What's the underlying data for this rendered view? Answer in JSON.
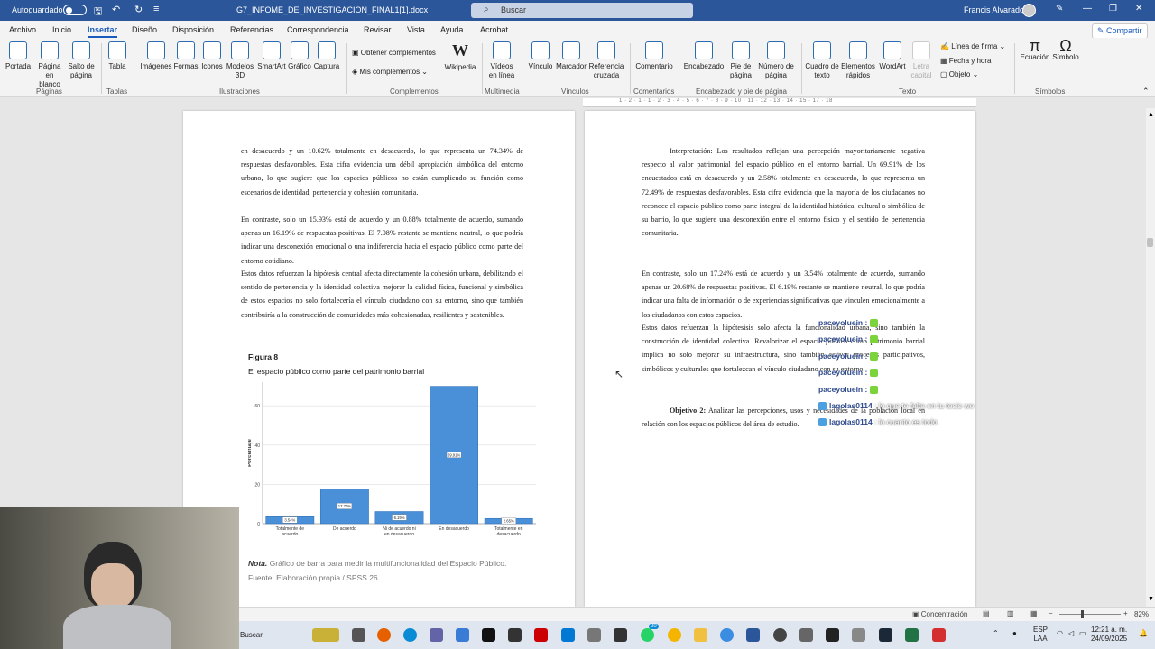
{
  "titlebar": {
    "autosave_label": "Autoguardado",
    "doc_title": "G7_INFOME_DE_INVESTIGACION_FINAL1[1].docx",
    "search_placeholder": "Buscar",
    "user_name": "Francis Alvarado"
  },
  "menu": {
    "tabs": [
      "Archivo",
      "Inicio",
      "Insertar",
      "Diseño",
      "Disposición",
      "Referencias",
      "Correspondencia",
      "Revisar",
      "Vista",
      "Ayuda",
      "Acrobat"
    ],
    "active_tab": "Insertar",
    "share_label": "Compartir"
  },
  "ribbon": {
    "buttons": {
      "portada": "Portada",
      "pagina_blanco_1": "Página",
      "pagina_blanco_2": "en blanco",
      "salto_1": "Salto de",
      "salto_2": "página",
      "tabla": "Tabla",
      "imagenes": "Imágenes",
      "formas": "Formas",
      "iconos": "Iconos",
      "modelos_1": "Modelos",
      "modelos_2": "3D",
      "smartart": "SmartArt",
      "grafico": "Gráfico",
      "captura": "Captura",
      "obtener": "Obtener complementos",
      "mis": "Mis complementos",
      "wikipedia": "Wikipedia",
      "videos_1": "Vídeos",
      "videos_2": "en línea",
      "vinculo": "Vínculo",
      "marcador": "Marcador",
      "referencia_1": "Referencia",
      "referencia_2": "cruzada",
      "comentario": "Comentario",
      "encabezado": "Encabezado",
      "pie_1": "Pie de",
      "pie_2": "página",
      "numero_1": "Número de",
      "numero_2": "página",
      "cuadro_1": "Cuadro de",
      "cuadro_2": "texto",
      "elementos_1": "Elementos",
      "elementos_2": "rápidos",
      "wordart": "WordArt",
      "letra_1": "Letra",
      "letra_2": "capital",
      "linea_firma": "Línea de firma",
      "fecha_hora": "Fecha y hora",
      "objeto": "Objeto",
      "ecuacion": "Ecuación",
      "simbolo": "Símbolo"
    },
    "groups": {
      "paginas": "Páginas",
      "tablas": "Tablas",
      "ilustraciones": "Ilustraciones",
      "complementos": "Complementos",
      "multimedia": "Multimedia",
      "vinculos": "Vínculos",
      "comentarios": "Comentarios",
      "encabezado": "Encabezado y pie de página",
      "texto": "Texto",
      "simbolos": "Símbolos"
    }
  },
  "ruler": {
    "ticks": "1 · 2 · 1 · 1 · 2 · 3 · 4 · 5 · 6 · 7 · 8 · 9 · 10 · 11 · 12 · 13 · 14 · 15 · 17 · 18"
  },
  "page1": {
    "para1": "en desacuerdo y un 10.62% totalmente en desacuerdo, lo que representa un 74.34% de respuestas desfavorables. Esta cifra evidencia una débil apropiación simbólica del entorno urbano, lo que sugiere que los espacios públicos no están cumpliendo su función como escenarios de identidad, pertenencia y cohesión comunitaria.",
    "para2": "En contraste, solo un 15.93% está de acuerdo y un 0.88% totalmente de acuerdo, sumando apenas un 16.19% de respuestas positivas. El 7.08% restante se mantiene neutral, lo que podría indicar una desconexión emocional o una indiferencia hacia el espacio público como parte del entorno cotidiano.",
    "para3": "Estos datos refuerzan la hipótesis central afecta directamente la cohesión urbana, debilitando el sentido de pertenencia y la identidad colectiva mejorar la calidad física, funcional y simbólica de estos espacios no solo fortalecería el vínculo ciudadano con su entorno, sino que también contribuiría a la construcción de comunidades más cohesionadas, resilientes y sostenibles.",
    "figure_title": "Figura 8",
    "figure_subtitle": "El espacio público como parte del patrimonio barrial",
    "note_label": "Nota.",
    "note_text": "Gráfico de barra para medir la multifuncionalidad del Espacio Público.",
    "source_text": "Fuente: Elaboración propia / SPSS 26"
  },
  "chart_data": {
    "type": "bar",
    "categories": [
      "Totalmente de acuerdo",
      "De acuerdo",
      "Ni de acuerdo ni en desacuerdo",
      "En desacuerdo",
      "Totalmente en desacuerdo"
    ],
    "category_lines": [
      [
        "Totalmente de",
        "acuerdo"
      ],
      [
        "De acuerdo"
      ],
      [
        "Ni de acuerdo ni",
        "en desacuerdo"
      ],
      [
        "En desacuerdo"
      ],
      [
        "Totalmente en",
        "desacuerdo"
      ]
    ],
    "values": [
      3.54,
      17.7,
      6.19,
      69.91,
      2.65
    ],
    "value_labels": [
      "3.54%",
      "17.70%",
      "6.19%",
      "69.91%",
      "2.65%"
    ],
    "ylabel": "Porcentaje",
    "xlabel": "",
    "yticks": [
      0,
      20,
      40,
      60
    ],
    "ylim": [
      0,
      72
    ],
    "bar_color": "#4a90d9",
    "grid": true
  },
  "page2": {
    "para1": "Interpretación: Los resultados reflejan una percepción mayoritariamente negativa respecto al valor patrimonial del espacio público en el entorno barrial. Un 69.91% de los encuestados está en desacuerdo y un 2.58% totalmente en desacuerdo, lo que representa un 72.49% de respuestas desfavorables. Esta cifra evidencia que la mayoría de los ciudadanos no reconoce el espacio público como parte integral de la identidad histórica, cultural o simbólica de su barrio, lo que sugiere una desconexión entre el entorno físico y el sentido de pertenencia comunitaria.",
    "para2": "En contraste, solo un 17.24% está de acuerdo y un 3.54% totalmente de acuerdo, sumando apenas un 20.68% de respuestas positivas. El 6.19% restante se mantiene neutral, lo que podría indicar una falta de información o de experiencias significativas que vinculen emocionalmente a los ciudadanos con estos espacios.",
    "para3": "Estos datos refuerzan la hipótesisis solo afecta la funcionalidad urbana, sino también la construcción de identidad colectiva. Revalorizar el espacio público como patrimonio barrial implica no solo mejorar su infraestructura, sino también activar procesos participativos, simbólicos y culturales que fortalezcan el vínculo ciudadano con su entorno.",
    "objective_label": "Objetivo 2:",
    "objective_text": "Analizar las percepciones, usos y necesidades de la población local en relación con los espacios públicos del área de estudio."
  },
  "chat": {
    "lines": [
      {
        "user": "paceyoluein :",
        "msg": ""
      },
      {
        "user": "paceyoluein :",
        "msg": ""
      },
      {
        "user": "paceyoluein :",
        "msg": ""
      },
      {
        "user": "paceyoluein :",
        "msg": ""
      },
      {
        "user": "paceyoluein :",
        "msg": ""
      },
      {
        "user": "lagolas0114",
        "msg": ": lo que te falta en tu tesis we"
      },
      {
        "user": "lagolas0114",
        "msg": ": lo cuanto es todo"
      }
    ]
  },
  "statusbar": {
    "focus_label": "Concentración",
    "zoom": "82%"
  },
  "taskbar": {
    "search_text": "Buscar",
    "lang_1": "ESP",
    "lang_2": "LAA",
    "time": "12:21 a. m.",
    "date": "24/09/2025",
    "badge_count": "20"
  }
}
